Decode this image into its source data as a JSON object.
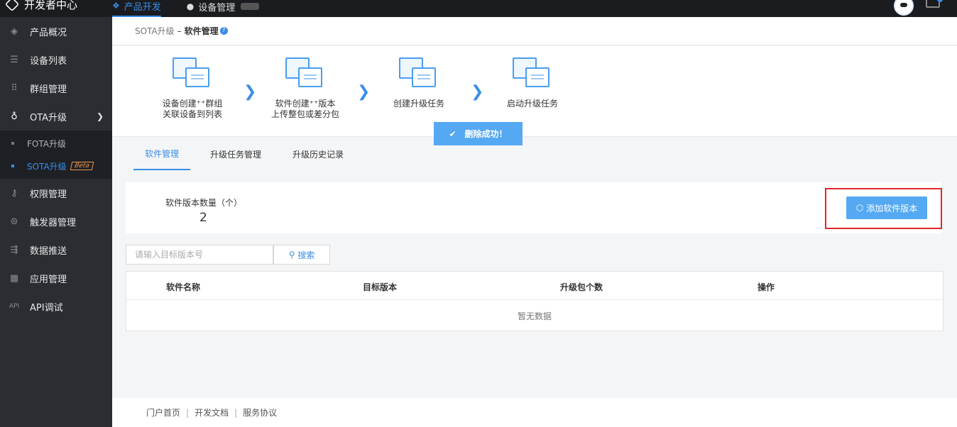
{
  "topbar": {
    "brand": "开发者中心",
    "nav": [
      {
        "label": "产品开发",
        "icon": "product-dev-icon"
      },
      {
        "label": "设备管理",
        "icon": "device-manage-icon"
      }
    ]
  },
  "sidebar": {
    "items": [
      {
        "label": "产品概况"
      },
      {
        "label": "设备列表"
      },
      {
        "label": "群组管理"
      },
      {
        "label": "OTA升级"
      },
      {
        "label": "权限管理"
      },
      {
        "label": "触发器管理"
      },
      {
        "label": "数据推送"
      },
      {
        "label": "应用管理"
      },
      {
        "label": "API调试"
      }
    ],
    "ota_sub": [
      {
        "label": "FOTA升级"
      },
      {
        "label": "SOTA升级",
        "badge": "Beta"
      }
    ]
  },
  "breadcrumb": {
    "parent": "SOTA升级",
    "separator": "–",
    "current": "软件管理",
    "help": "?"
  },
  "steps": [
    {
      "line1": "设备创建⁺⁺群组",
      "line2": "关联设备到列表"
    },
    {
      "line1": "软件创建⁺⁺版本",
      "line2": "上传整包或差分包"
    },
    {
      "line1": "创建升级任务",
      "line2": ""
    },
    {
      "line1": "启动升级任务",
      "line2": ""
    }
  ],
  "toast": {
    "text": "删除成功！"
  },
  "tabs": [
    {
      "label": "软件管理"
    },
    {
      "label": "升级任务管理"
    },
    {
      "label": "升级历史记录"
    }
  ],
  "stats": {
    "label": "软件版本数量（个）",
    "value": "2",
    "add_button": "添加软件版本"
  },
  "search": {
    "placeholder": "请输入目标版本号",
    "button": "搜索"
  },
  "table": {
    "columns": [
      "软件名称",
      "目标版本",
      "升级包个数",
      "操作"
    ],
    "empty": "暂无数据"
  },
  "footer": {
    "links": [
      "门户首页",
      "开发文档",
      "服务协议"
    ],
    "separator": "|"
  },
  "colors": {
    "accent": "#3a8ee6",
    "button": "#55a9f3",
    "highlight_border": "#e1262a",
    "sidebar_bg": "#2b2d33",
    "topbar_bg": "#1a1c20"
  }
}
